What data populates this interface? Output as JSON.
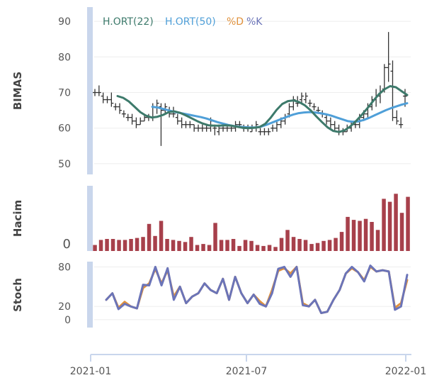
{
  "chart_data": {
    "type": "stock",
    "x_ticks": [
      "2021-01",
      "2021-07",
      "2022-01"
    ],
    "legend": [
      {
        "label": "H.ORT(22)",
        "color": "#3d7a6b"
      },
      {
        "label": "H.ORT(50)",
        "color": "#4f9fd8"
      },
      {
        "label": "%D",
        "color": "#e0913c"
      },
      {
        "label": "%K",
        "color": "#6b74b8"
      }
    ],
    "colors": {
      "volume": "#a7404b",
      "ohlc": "#333333",
      "axis_band": "#c9d6ec",
      "grid": "#eeeeee"
    },
    "panels": [
      {
        "ylabel": "BIMAS",
        "yticks": [
          50,
          60,
          70,
          80,
          90
        ],
        "ylim": [
          47,
          94
        ],
        "ohlc": [
          {
            "o": 70,
            "h": 71,
            "l": 69,
            "c": 70
          },
          {
            "o": 70,
            "h": 72,
            "l": 69,
            "c": 70
          },
          {
            "o": 69,
            "h": 70,
            "l": 67,
            "c": 68
          },
          {
            "o": 68,
            "h": 69,
            "l": 67,
            "c": 68
          },
          {
            "o": 68,
            "h": 70,
            "l": 66,
            "c": 67
          },
          {
            "o": 66,
            "h": 67,
            "l": 65,
            "c": 66
          },
          {
            "o": 66,
            "h": 67,
            "l": 64,
            "c": 65
          },
          {
            "o": 64,
            "h": 65,
            "l": 63,
            "c": 64
          },
          {
            "o": 63,
            "h": 64,
            "l": 62,
            "c": 63
          },
          {
            "o": 63,
            "h": 64,
            "l": 61,
            "c": 62
          },
          {
            "o": 62,
            "h": 63,
            "l": 60,
            "c": 61
          },
          {
            "o": 61,
            "h": 63,
            "l": 61,
            "c": 62
          },
          {
            "o": 62,
            "h": 64,
            "l": 62,
            "c": 63
          },
          {
            "o": 63,
            "h": 64,
            "l": 62,
            "c": 63
          },
          {
            "o": 63,
            "h": 67,
            "l": 62,
            "c": 66
          },
          {
            "o": 66,
            "h": 68,
            "l": 64,
            "c": 67
          },
          {
            "o": 66,
            "h": 67,
            "l": 55,
            "c": 65
          },
          {
            "o": 65,
            "h": 67,
            "l": 64,
            "c": 66
          },
          {
            "o": 65,
            "h": 66,
            "l": 63,
            "c": 64
          },
          {
            "o": 64,
            "h": 66,
            "l": 63,
            "c": 64
          },
          {
            "o": 63,
            "h": 64,
            "l": 61,
            "c": 62
          },
          {
            "o": 62,
            "h": 63,
            "l": 60,
            "c": 61
          },
          {
            "o": 61,
            "h": 62,
            "l": 60,
            "c": 61
          },
          {
            "o": 61,
            "h": 62,
            "l": 60,
            "c": 61
          },
          {
            "o": 61,
            "h": 61,
            "l": 59,
            "c": 60
          },
          {
            "o": 60,
            "h": 61,
            "l": 59,
            "c": 60
          },
          {
            "o": 60,
            "h": 61,
            "l": 59,
            "c": 60
          },
          {
            "o": 60,
            "h": 61,
            "l": 59,
            "c": 60
          },
          {
            "o": 60,
            "h": 63,
            "l": 59,
            "c": 62
          },
          {
            "o": 60,
            "h": 61,
            "l": 58,
            "c": 60
          },
          {
            "o": 59,
            "h": 61,
            "l": 58,
            "c": 60
          },
          {
            "o": 60,
            "h": 61,
            "l": 59,
            "c": 60
          },
          {
            "o": 60,
            "h": 61,
            "l": 59,
            "c": 60
          },
          {
            "o": 60,
            "h": 61,
            "l": 59,
            "c": 60
          },
          {
            "o": 60,
            "h": 62,
            "l": 59,
            "c": 61
          },
          {
            "o": 61,
            "h": 62,
            "l": 60,
            "c": 61
          },
          {
            "o": 60,
            "h": 61,
            "l": 59,
            "c": 60
          },
          {
            "o": 60,
            "h": 61,
            "l": 59,
            "c": 60
          },
          {
            "o": 59,
            "h": 61,
            "l": 59,
            "c": 60
          },
          {
            "o": 60,
            "h": 62,
            "l": 59,
            "c": 61
          },
          {
            "o": 59,
            "h": 60,
            "l": 58,
            "c": 59
          },
          {
            "o": 59,
            "h": 60,
            "l": 58,
            "c": 59
          },
          {
            "o": 59,
            "h": 60,
            "l": 58,
            "c": 59
          },
          {
            "o": 60,
            "h": 61,
            "l": 59,
            "c": 60
          },
          {
            "o": 60,
            "h": 62,
            "l": 59,
            "c": 61
          },
          {
            "o": 61,
            "h": 63,
            "l": 60,
            "c": 62
          },
          {
            "o": 62,
            "h": 64,
            "l": 61,
            "c": 63
          },
          {
            "o": 64,
            "h": 67,
            "l": 63,
            "c": 66
          },
          {
            "o": 66,
            "h": 69,
            "l": 65,
            "c": 68
          },
          {
            "o": 67,
            "h": 69,
            "l": 66,
            "c": 67
          },
          {
            "o": 68,
            "h": 70,
            "l": 67,
            "c": 69
          },
          {
            "o": 68,
            "h": 70,
            "l": 67,
            "c": 69
          },
          {
            "o": 67,
            "h": 68,
            "l": 66,
            "c": 67
          },
          {
            "o": 66,
            "h": 67,
            "l": 65,
            "c": 66
          },
          {
            "o": 65,
            "h": 66,
            "l": 64,
            "c": 65
          },
          {
            "o": 64,
            "h": 65,
            "l": 63,
            "c": 64
          },
          {
            "o": 63,
            "h": 64,
            "l": 61,
            "c": 62
          },
          {
            "o": 62,
            "h": 63,
            "l": 60,
            "c": 61
          },
          {
            "o": 61,
            "h": 62,
            "l": 59,
            "c": 60
          },
          {
            "o": 60,
            "h": 61,
            "l": 58,
            "c": 59
          },
          {
            "o": 59,
            "h": 60,
            "l": 58,
            "c": 59
          },
          {
            "o": 59,
            "h": 61,
            "l": 59,
            "c": 60
          },
          {
            "o": 60,
            "h": 62,
            "l": 59,
            "c": 61
          },
          {
            "o": 61,
            "h": 62,
            "l": 60,
            "c": 61
          },
          {
            "o": 61,
            "h": 64,
            "l": 60,
            "c": 63
          },
          {
            "o": 63,
            "h": 65,
            "l": 62,
            "c": 64
          },
          {
            "o": 64,
            "h": 67,
            "l": 63,
            "c": 66
          },
          {
            "o": 66,
            "h": 69,
            "l": 65,
            "c": 68
          },
          {
            "o": 68,
            "h": 71,
            "l": 66,
            "c": 69
          },
          {
            "o": 69,
            "h": 72,
            "l": 67,
            "c": 70
          },
          {
            "o": 71,
            "h": 78,
            "l": 70,
            "c": 77
          },
          {
            "o": 77,
            "h": 87,
            "l": 73,
            "c": 78
          },
          {
            "o": 76,
            "h": 79,
            "l": 62,
            "c": 63
          },
          {
            "o": 63,
            "h": 65,
            "l": 61,
            "c": 62
          },
          {
            "o": 61,
            "h": 63,
            "l": 60,
            "c": 61
          },
          {
            "o": 69,
            "h": 71,
            "l": 66,
            "c": 69
          }
        ],
        "series": [
          {
            "name": "H.ORT(22)",
            "y": [
              69,
              68.5,
              67.5,
              66,
              64.5,
              63.5,
              63,
              63.2,
              63.7,
              64.5,
              64.7,
              64.3,
              63.6,
              62.8,
              62,
              61.3,
              60.8,
              60.7,
              60.7,
              60.8,
              60.7,
              60.4,
              60.1,
              60,
              60.1,
              60.3,
              61.2,
              63,
              65.1,
              66.8,
              67.6,
              67.8,
              67.3,
              66.4,
              65,
              63.3,
              61.7,
              60.2,
              59.2,
              58.9,
              59.4,
              60.5,
              62,
              63.7,
              65.6,
              67.6,
              69.5,
              70.9,
              71.8,
              71.5,
              70.4,
              69.3
            ]
          },
          {
            "name": "H.ORT(50)",
            "y": [
              66,
              65.8,
              65.4,
              65,
              64.6,
              64.3,
              64,
              63.7,
              63.4,
              63.1,
              62.7,
              62.2,
              61.7,
              61.3,
              60.9,
              60.6,
              60.4,
              60.3,
              60.2,
              60.2,
              60.4,
              60.9,
              61.5,
              62.1,
              62.7,
              63.3,
              63.8,
              64.2,
              64.4,
              64.5,
              64.4,
              64.2,
              63.9,
              63.5,
              63,
              62.5,
              62,
              61.8,
              61.9,
              62.3,
              62.9,
              63.6,
              64.3,
              65,
              65.6,
              66.1,
              66.6,
              67
            ]
          }
        ]
      },
      {
        "ylabel": "Hacim",
        "yticks": [
          0
        ],
        "ylim": [
          0,
          65
        ],
        "volume": [
          6,
          11,
          12,
          12,
          11,
          11,
          12,
          13,
          14,
          27,
          15,
          30,
          12,
          11,
          10,
          9,
          14,
          6,
          7,
          6,
          28,
          11,
          11,
          12,
          5,
          11,
          10,
          6,
          5,
          6,
          4,
          13,
          21,
          14,
          12,
          11,
          7,
          8,
          10,
          11,
          13,
          19,
          34,
          31,
          30,
          32,
          29,
          21,
          52,
          49,
          57,
          38,
          54
        ]
      },
      {
        "ylabel": "Stoch",
        "yticks": [
          0,
          20,
          80
        ],
        "ylim": [
          -12,
          88
        ],
        "series": [
          {
            "name": "%D",
            "y": [
              30,
              40,
              18,
              27,
              20,
              17,
              48,
              55,
              77,
              55,
              75,
              35,
              50,
              25,
              35,
              40,
              55,
              45,
              40,
              62,
              30,
              65,
              40,
              25,
              38,
              28,
              20,
              45,
              74,
              78,
              70,
              80,
              25,
              20,
              30,
              10,
              12,
              30,
              45,
              70,
              78,
              72,
              60,
              80,
              73,
              75,
              73,
              18,
              25,
              60
            ]
          },
          {
            "name": "%K",
            "y": [
              30,
              40,
              16,
              24,
              20,
              17,
              53,
              52,
              80,
              52,
              78,
              30,
              50,
              25,
              35,
              40,
              55,
              45,
              40,
              62,
              30,
              65,
              40,
              25,
              38,
              24,
              20,
              40,
              77,
              80,
              65,
              80,
              22,
              20,
              30,
              10,
              12,
              30,
              45,
              70,
              80,
              72,
              58,
              82,
              73,
              75,
              73,
              15,
              20,
              68
            ]
          }
        ]
      }
    ]
  }
}
